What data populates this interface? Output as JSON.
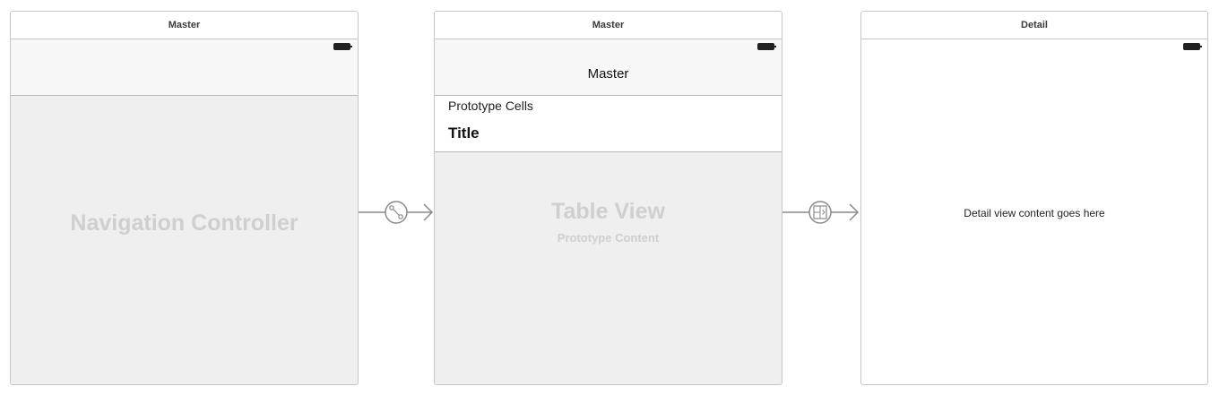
{
  "scenes": {
    "nav": {
      "title": "Master",
      "label": "Navigation Controller"
    },
    "master": {
      "title": "Master",
      "nav_title": "Master",
      "section_header": "Prototype Cells",
      "cell_title": "Title",
      "table_label": "Table View",
      "table_sublabel": "Prototype Content"
    },
    "detail": {
      "title": "Detail",
      "content": "Detail view content goes here"
    }
  },
  "segues": [
    {
      "icon": "relationship-segue-icon"
    },
    {
      "icon": "show-segue-icon"
    }
  ],
  "colors": {
    "canvas": "#ffffff",
    "scene_border": "#c6c6c6",
    "content_gray": "#efefef",
    "placeholder_text": "#cfcfcf",
    "arrow": "#8a8a8a"
  }
}
